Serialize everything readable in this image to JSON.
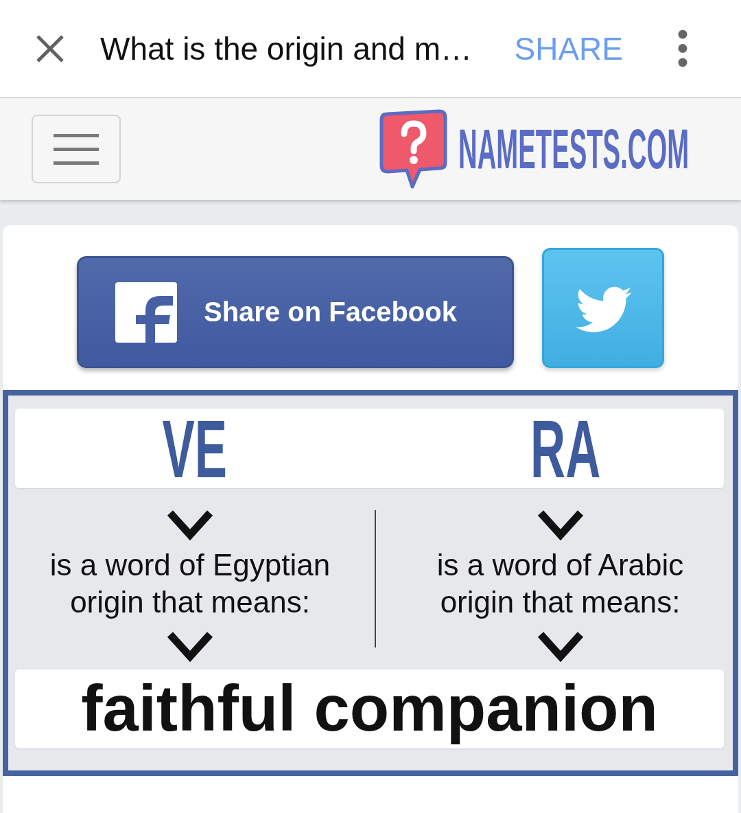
{
  "top_bar": {
    "title": "What is the origin and m…",
    "share": "SHARE"
  },
  "site_header": {
    "logo_text": "NAMETESTS.COM"
  },
  "share_buttons": [
    {
      "kind": "facebook",
      "label": "Share on Facebook"
    },
    {
      "kind": "twitter"
    }
  ],
  "result": {
    "syllables": [
      {
        "text": "VE",
        "description": "is a word of Egyptian origin that means:"
      },
      {
        "text": "RA",
        "description": "is a word of Arabic origin that means:"
      }
    ],
    "meaning": "faithful companion"
  }
}
